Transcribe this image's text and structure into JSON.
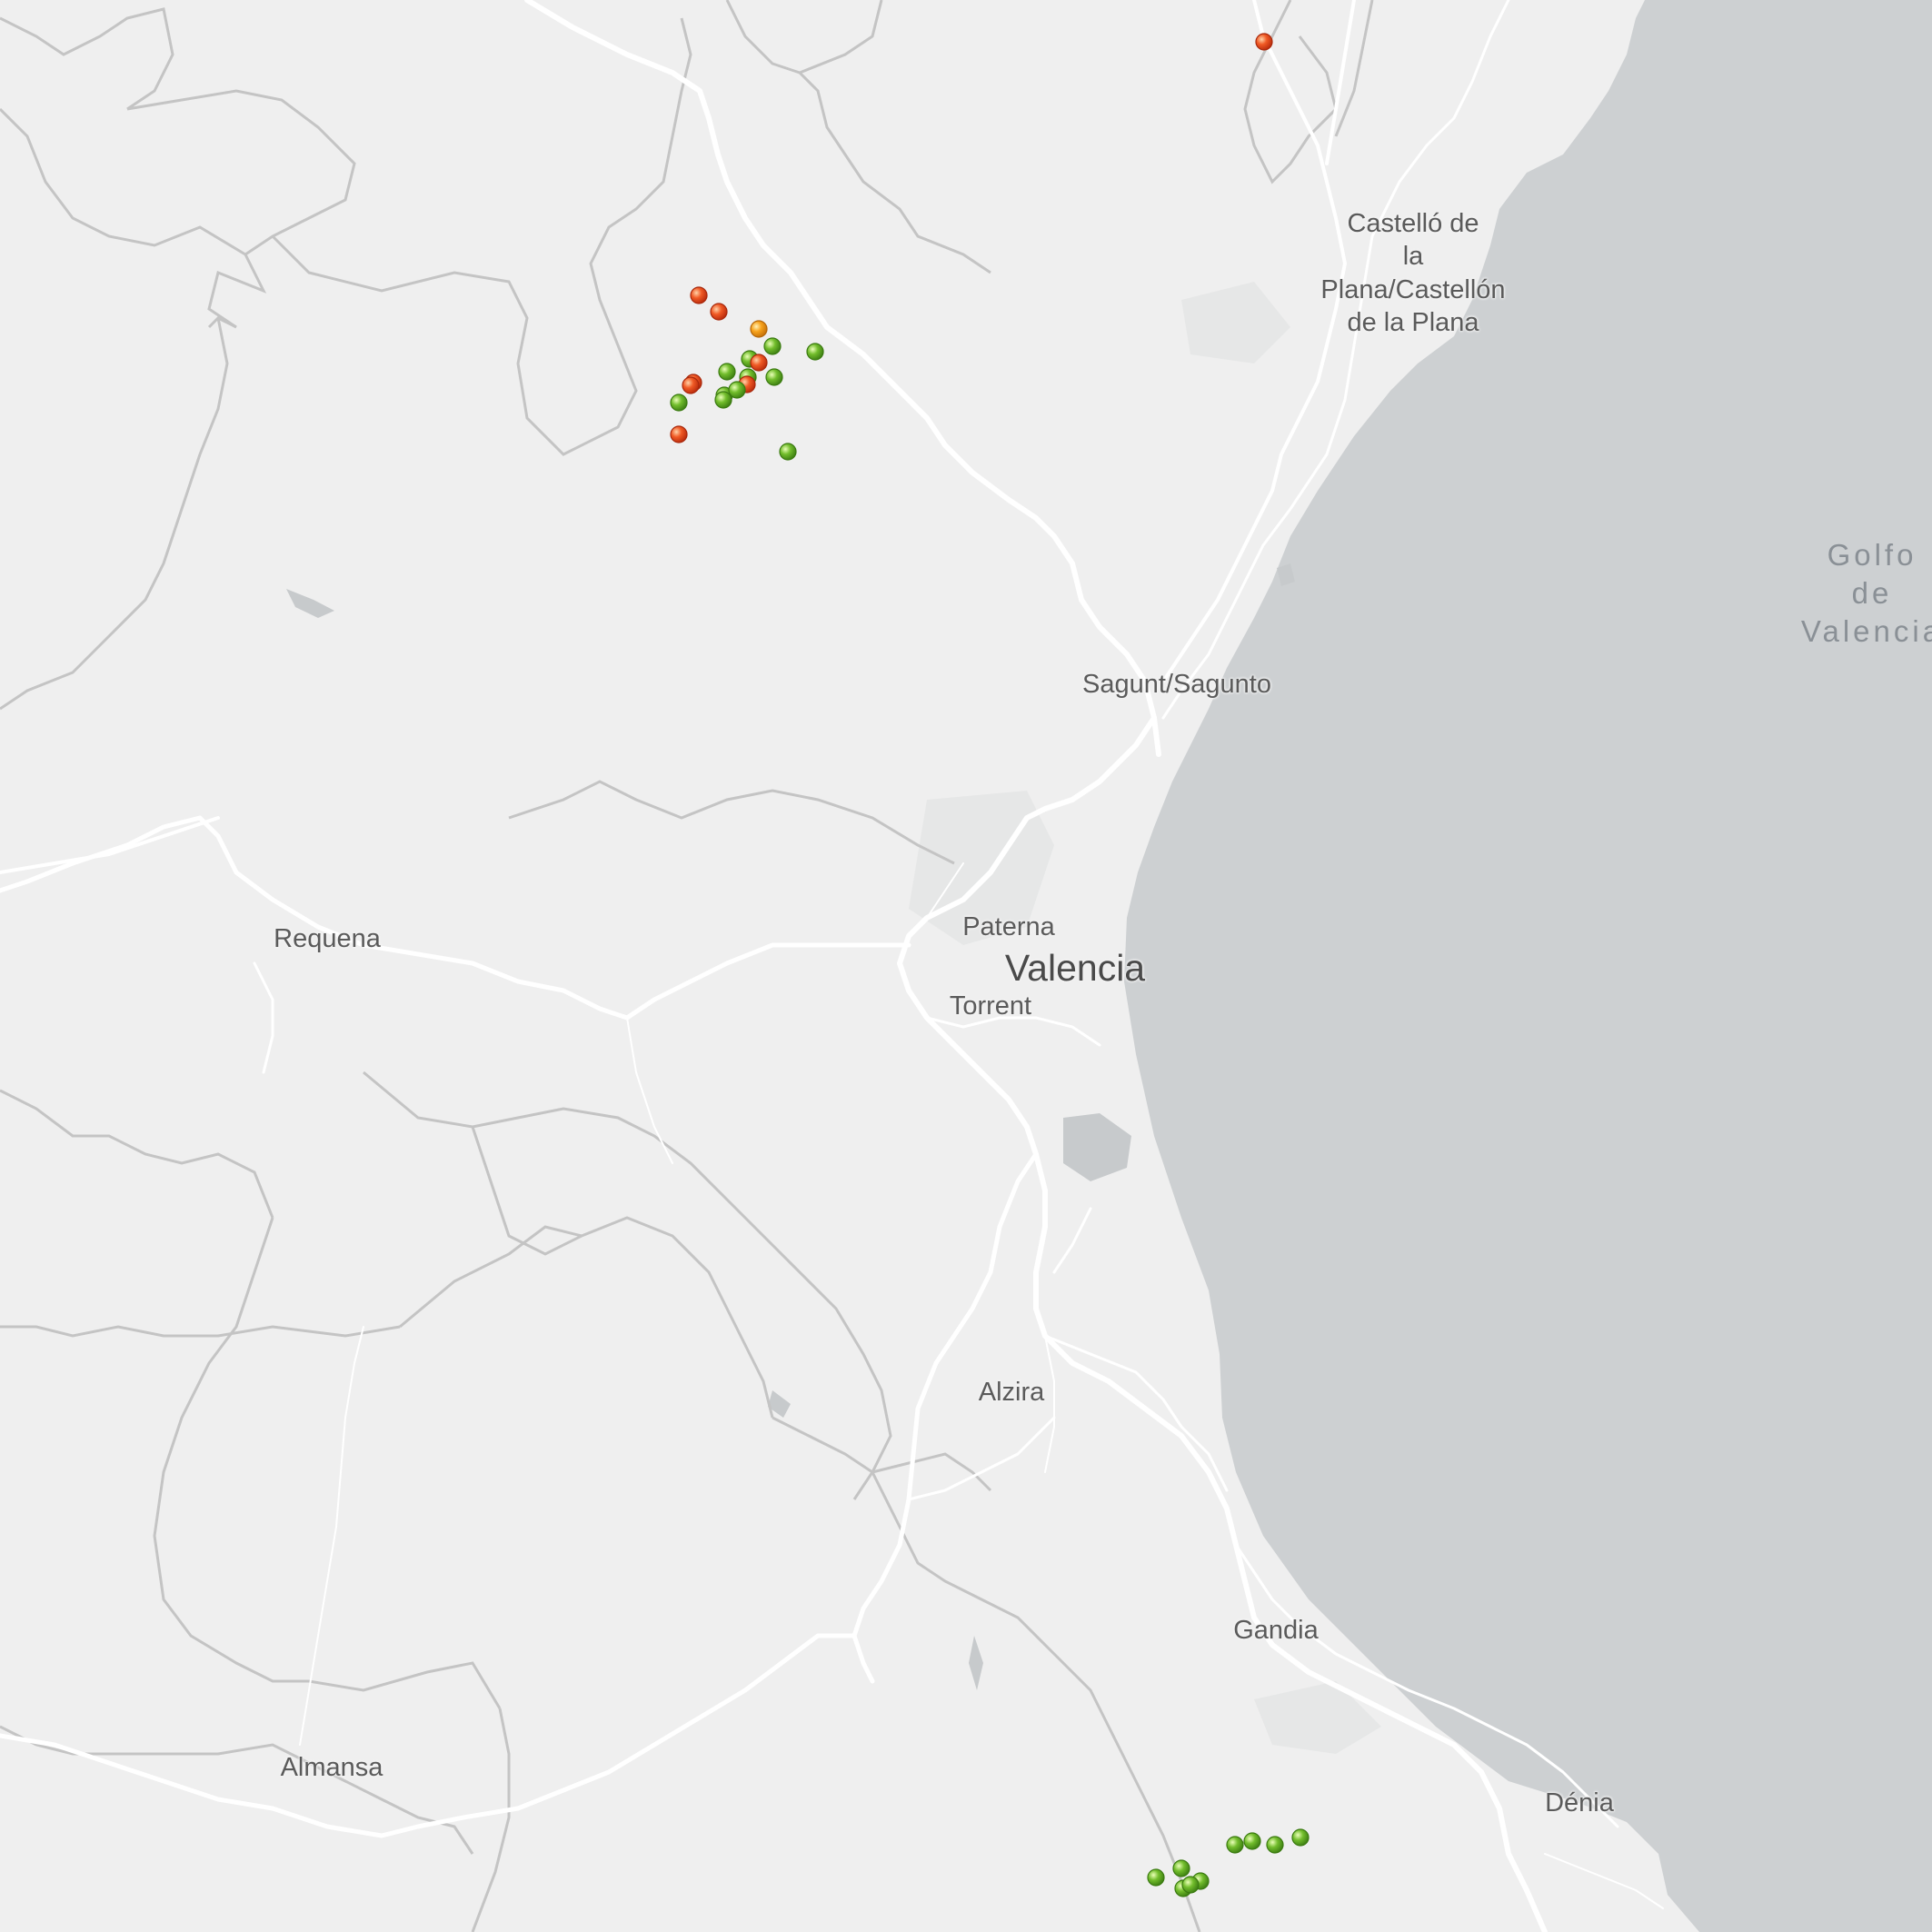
{
  "map": {
    "background_color": "#efefef",
    "sea_color": "#cdd0d2",
    "road_color": "#ffffff",
    "boundary_color": "#c4c4c4",
    "labels": {
      "castello": "Castelló de\nla\nPlana/Castellón\nde la Plana",
      "sagunt": "Sagunt/Sagunto",
      "paterna": "Paterna",
      "valencia": "Valencia",
      "torrent": "Torrent",
      "requena": "Requena",
      "alzira": "Alzira",
      "gandia": "Gandia",
      "denia": "Dénia",
      "almansa": "Almansa",
      "golfo": "Golfo\nde\nValencia"
    },
    "marker_colors": {
      "red": "#e8431c",
      "orange": "#f7a21b",
      "green": "#6ab52a"
    },
    "markers": [
      {
        "status": "red"
      },
      {
        "status": "red"
      },
      {
        "status": "red"
      },
      {
        "status": "orange"
      },
      {
        "status": "green"
      },
      {
        "status": "green"
      },
      {
        "status": "green"
      },
      {
        "status": "red"
      },
      {
        "status": "red"
      },
      {
        "status": "green"
      },
      {
        "status": "green"
      },
      {
        "status": "red"
      },
      {
        "status": "red"
      },
      {
        "status": "green"
      },
      {
        "status": "green"
      },
      {
        "status": "green"
      },
      {
        "status": "red"
      },
      {
        "status": "green"
      },
      {
        "status": "green"
      },
      {
        "status": "green"
      },
      {
        "status": "green"
      },
      {
        "status": "green"
      },
      {
        "status": "green"
      },
      {
        "status": "green"
      },
      {
        "status": "green"
      },
      {
        "status": "green"
      },
      {
        "status": "green"
      },
      {
        "status": "green"
      },
      {
        "status": "green"
      }
    ]
  }
}
